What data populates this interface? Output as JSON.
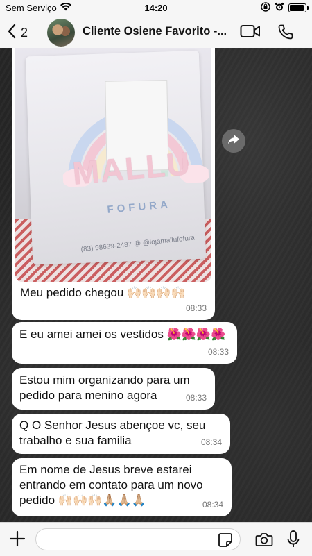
{
  "status_bar": {
    "carrier": "Sem Serviço",
    "time": "14:20",
    "battery_level": 0.85
  },
  "header": {
    "back_count": "2",
    "contact_name": "Cliente Osiene Favorito -...",
    "icons": [
      "chevron-left-icon",
      "video-call-icon",
      "phone-icon"
    ]
  },
  "photo_message": {
    "brand_text": "MALLU",
    "brand_sub": "FOFURA",
    "brand_contact": "(83) 98639-2487  @ @lojamallufofura",
    "caption": "Meu pedido chegou 🙌🏻🙌🏻🙌🏻🙌🏻",
    "time": "08:33"
  },
  "messages": [
    {
      "text": "E eu amei amei os vestidos 🌺🌺🌺🌺",
      "time": "08:33"
    },
    {
      "text": "Estou mim organizando para um pedido para menino agora",
      "time": "08:33"
    },
    {
      "text": "Q O Senhor Jesus abençoe vc, seu trabalho  e sua familia",
      "time": "08:34"
    },
    {
      "text": "Em nome de Jesus breve estarei entrando em contato para um novo pedido 🙌🏻🙌🏻🙌🏻🙏🏼🙏🏼🙏🏼",
      "time": "08:34"
    }
  ],
  "input_bar": {
    "placeholder": "",
    "icons": [
      "plus-icon",
      "sticker-icon",
      "camera-icon",
      "microphone-icon"
    ]
  },
  "colors": {
    "bubble": "#ffffff",
    "header_bg": "#f6f6f6",
    "wallpaper": "#262626"
  }
}
